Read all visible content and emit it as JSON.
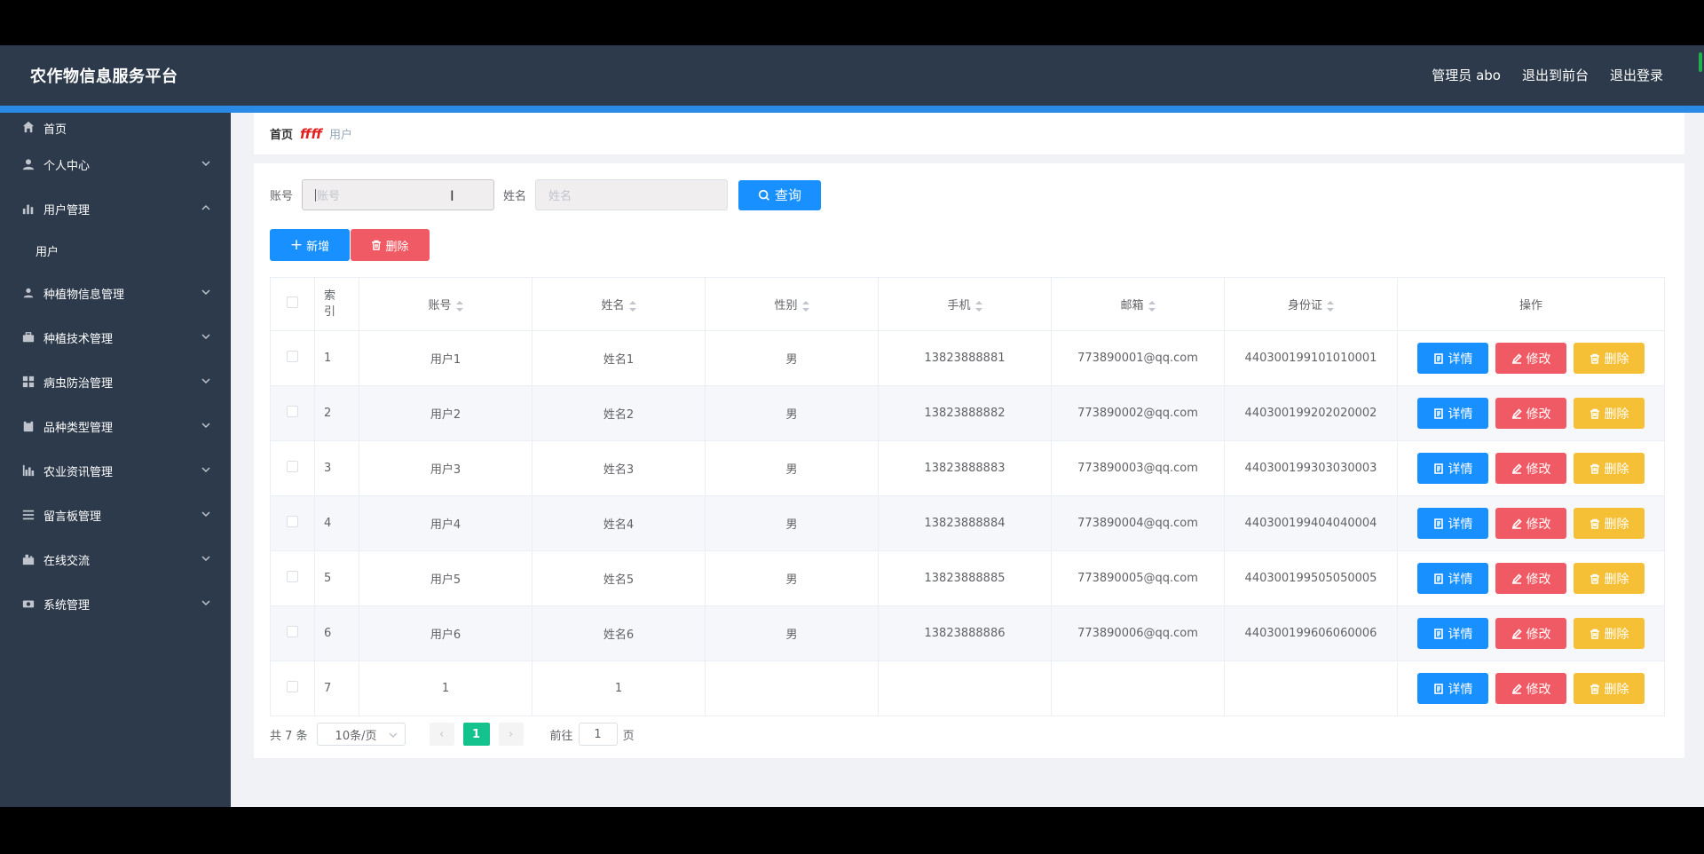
{
  "header": {
    "logo": "农作物信息服务平台",
    "user_label": "管理员 abo",
    "back_label": "退出到前台",
    "logout_label": "退出登录"
  },
  "sidebar": {
    "items": [
      {
        "label": "首页",
        "icon": "home-icon"
      },
      {
        "label": "个人中心",
        "icon": "user-icon"
      },
      {
        "label": "用户管理",
        "icon": "chart-icon",
        "expanded": true,
        "sub": [
          "用户"
        ]
      },
      {
        "label": "种植物信息管理",
        "icon": "person-icon"
      },
      {
        "label": "种植技术管理",
        "icon": "briefcase-icon"
      },
      {
        "label": "病虫防治管理",
        "icon": "grid-icon"
      },
      {
        "label": "品种类型管理",
        "icon": "clipboard-icon"
      },
      {
        "label": "农业资讯管理",
        "icon": "stats-icon"
      },
      {
        "label": "留言板管理",
        "icon": "list-icon"
      },
      {
        "label": "在线交流",
        "icon": "chat-icon"
      },
      {
        "label": "系统管理",
        "icon": "settings-icon"
      }
    ]
  },
  "breadcrumb": {
    "home": "首页",
    "current": "用户"
  },
  "search": {
    "account_label": "账号",
    "account_placeholder": "账号",
    "name_label": "姓名",
    "name_placeholder": "姓名",
    "query_label": "查询"
  },
  "actions": {
    "add_label": "新增",
    "delete_label": "删除"
  },
  "table": {
    "headers": [
      "索引",
      "账号",
      "姓名",
      "性别",
      "手机",
      "邮箱",
      "身份证",
      "操作"
    ],
    "rows": [
      {
        "index": "1",
        "account": "用户1",
        "name": "姓名1",
        "gender": "男",
        "phone": "13823888881",
        "email": "773890001@qq.com",
        "idcard": "440300199101010001"
      },
      {
        "index": "2",
        "account": "用户2",
        "name": "姓名2",
        "gender": "男",
        "phone": "13823888882",
        "email": "773890002@qq.com",
        "idcard": "440300199202020002"
      },
      {
        "index": "3",
        "account": "用户3",
        "name": "姓名3",
        "gender": "男",
        "phone": "13823888883",
        "email": "773890003@qq.com",
        "idcard": "440300199303030003"
      },
      {
        "index": "4",
        "account": "用户4",
        "name": "姓名4",
        "gender": "男",
        "phone": "13823888884",
        "email": "773890004@qq.com",
        "idcard": "440300199404040004"
      },
      {
        "index": "5",
        "account": "用户5",
        "name": "姓名5",
        "gender": "男",
        "phone": "13823888885",
        "email": "773890005@qq.com",
        "idcard": "440300199505050005"
      },
      {
        "index": "6",
        "account": "用户6",
        "name": "姓名6",
        "gender": "男",
        "phone": "13823888886",
        "email": "773890006@qq.com",
        "idcard": "440300199606060006"
      },
      {
        "index": "7",
        "account": "1",
        "name": "1",
        "gender": "",
        "phone": "",
        "email": "",
        "idcard": ""
      }
    ],
    "op_detail": "详情",
    "op_edit": "修改",
    "op_delete": "删除"
  },
  "pagination": {
    "total": "共 7 条",
    "page_size": "10条/页",
    "current_page": "1",
    "goto_prefix": "前往",
    "goto_value": "1",
    "goto_suffix": "页"
  },
  "colors": {
    "header_bg": "#2d3a4b",
    "accent": "#1890ff",
    "danger": "#f05a64",
    "warning": "#f5c036",
    "page_active": "#13c28c"
  }
}
